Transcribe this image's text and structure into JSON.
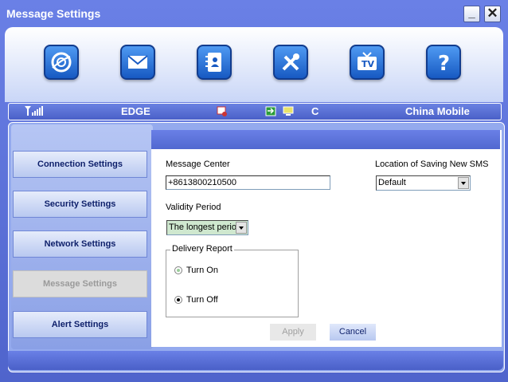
{
  "window": {
    "title": "Message Settings",
    "minimize_label": "_",
    "close_label": "✕"
  },
  "toolbar": {
    "icons": [
      {
        "name": "internet-icon"
      },
      {
        "name": "sms-icon"
      },
      {
        "name": "phonebook-icon"
      },
      {
        "name": "settings-icon"
      },
      {
        "name": "tv-icon"
      },
      {
        "name": "help-icon"
      }
    ]
  },
  "status": {
    "network_type": "EDGE",
    "connection": "C",
    "operator": "China Mobile"
  },
  "sidebar": {
    "items": [
      {
        "label": "Connection Settings",
        "active": false
      },
      {
        "label": "Security Settings",
        "active": false
      },
      {
        "label": "Network Settings",
        "active": false
      },
      {
        "label": "Message Settings",
        "active": true
      },
      {
        "label": "Alert Settings",
        "active": false
      }
    ]
  },
  "form": {
    "message_center_label": "Message Center",
    "message_center_value": "+8613800210500",
    "saving_location_label": "Location of Saving New SMS",
    "saving_location_value": "Default",
    "validity_label": "Validity Period",
    "validity_value": "The longest perio",
    "delivery_label": "Delivery Report",
    "turn_on_label": "Turn On",
    "turn_off_label": "Turn Off",
    "delivery_selected": "Turn Off",
    "apply_label": "Apply",
    "cancel_label": "Cancel"
  },
  "colors": {
    "accent": "#4f64cc",
    "panel": "#ffffff",
    "validity_bg": "#cfe8cf"
  }
}
